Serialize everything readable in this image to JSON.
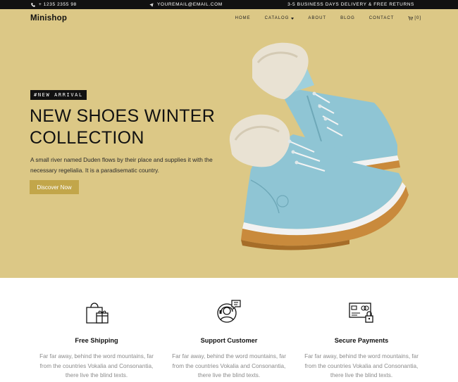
{
  "topbar": {
    "phone": "+ 1235 2355 98",
    "email": "YOUREMAIL@EMAIL.COM",
    "promo": "3-5 BUSINESS DAYS DELIVERY & FREE RETURNS",
    "phone_icon": "phone-icon",
    "email_icon": "paper-plane-icon"
  },
  "nav": {
    "brand": "Minishop",
    "items": [
      "HOME",
      "CATALOG",
      "ABOUT",
      "BLOG",
      "CONTACT"
    ],
    "cart_label": "[0]",
    "cart_icon": "cart-icon"
  },
  "hero": {
    "badge": "#NEW ARRIVAL",
    "headline_line1": "NEW SHOES WINTER",
    "headline_line2": "COLLECTION",
    "description": "A small river named Duden flows by their place and supplies it with the necessary regelialia. It is a paradisematic country.",
    "cta": "Discover Now",
    "background_color": "#dcc886",
    "cta_color": "#c2a64a",
    "image": "light-blue-winter-boots"
  },
  "features": [
    {
      "icon": "gift-bag-icon",
      "title": "Free Shipping",
      "text": "Far far away, behind the word mountains, far from the countries Vokalia and Consonantia, there live the blind texts."
    },
    {
      "icon": "support-agent-icon",
      "title": "Support Customer",
      "text": "Far far away, behind the word mountains, far from the countries Vokalia and Consonantia, there live the blind texts."
    },
    {
      "icon": "secure-card-icon",
      "title": "Secure Payments",
      "text": "Far far away, behind the word mountains, far from the countries Vokalia and Consonantia, there live the blind texts."
    }
  ]
}
